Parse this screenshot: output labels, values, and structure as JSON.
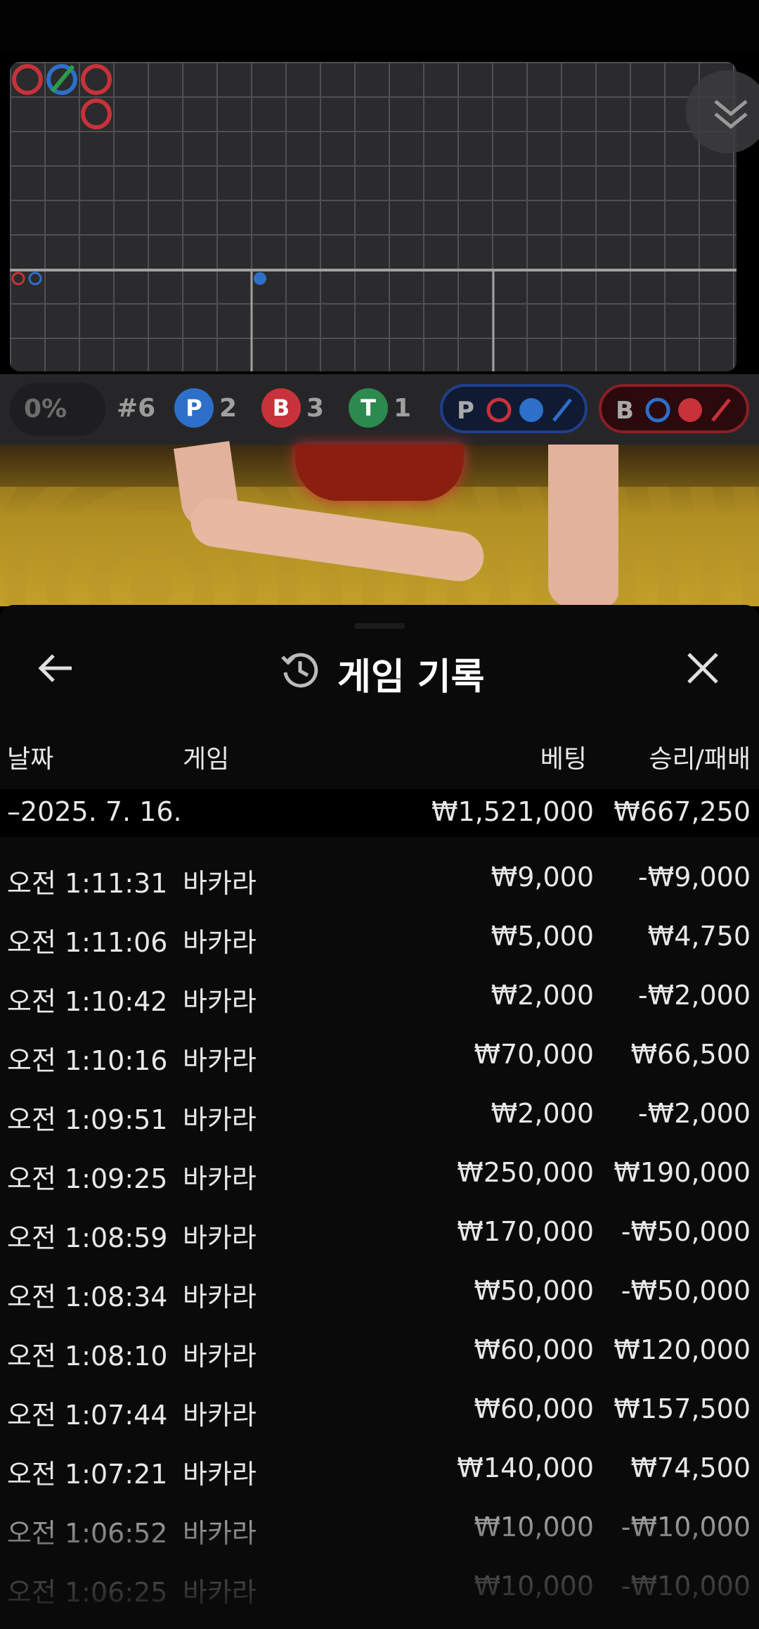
{
  "roadmap": {
    "collapse_icon": "chevron-double-down-icon"
  },
  "stats": {
    "percent": "0%",
    "round": "#6",
    "player": {
      "letter": "P",
      "count": "2",
      "color": "#2e6fc9"
    },
    "banker": {
      "letter": "B",
      "count": "3",
      "color": "#c8323a"
    },
    "tie": {
      "letter": "T",
      "count": "1",
      "color": "#2d8a4e"
    },
    "player_predict": {
      "letter": "P"
    },
    "banker_predict": {
      "letter": "B"
    }
  },
  "panel": {
    "title": "게임 기록",
    "title_icon": "history-icon",
    "back_icon": "arrow-left-icon",
    "close_icon": "close-icon",
    "columns": {
      "date": "날짜",
      "game": "게임",
      "bet": "베팅",
      "winloss": "승리/패배"
    },
    "date_row": {
      "date": "–2025. 7. 16.",
      "bet": "₩1,521,000",
      "winloss": "₩667,250"
    },
    "rows": [
      {
        "time": "오전 1:11:31",
        "game": "바카라",
        "bet": "₩9,000",
        "winloss": "-₩9,000"
      },
      {
        "time": "오전 1:11:06",
        "game": "바카라",
        "bet": "₩5,000",
        "winloss": "₩4,750"
      },
      {
        "time": "오전 1:10:42",
        "game": "바카라",
        "bet": "₩2,000",
        "winloss": "-₩2,000"
      },
      {
        "time": "오전 1:10:16",
        "game": "바카라",
        "bet": "₩70,000",
        "winloss": "₩66,500"
      },
      {
        "time": "오전 1:09:51",
        "game": "바카라",
        "bet": "₩2,000",
        "winloss": "-₩2,000"
      },
      {
        "time": "오전 1:09:25",
        "game": "바카라",
        "bet": "₩250,000",
        "winloss": "₩190,000"
      },
      {
        "time": "오전 1:08:59",
        "game": "바카라",
        "bet": "₩170,000",
        "winloss": "-₩50,000"
      },
      {
        "time": "오전 1:08:34",
        "game": "바카라",
        "bet": "₩50,000",
        "winloss": "-₩50,000"
      },
      {
        "time": "오전 1:08:10",
        "game": "바카라",
        "bet": "₩60,000",
        "winloss": "₩120,000"
      },
      {
        "time": "오전 1:07:44",
        "game": "바카라",
        "bet": "₩60,000",
        "winloss": "₩157,500"
      },
      {
        "time": "오전 1:07:21",
        "game": "바카라",
        "bet": "₩140,000",
        "winloss": "₩74,500"
      },
      {
        "time": "오전 1:06:52",
        "game": "바카라",
        "bet": "₩10,000",
        "winloss": "-₩10,000"
      },
      {
        "time": "오전 1:06:25",
        "game": "바카라",
        "bet": "₩10,000",
        "winloss": "-₩10,000"
      }
    ]
  }
}
